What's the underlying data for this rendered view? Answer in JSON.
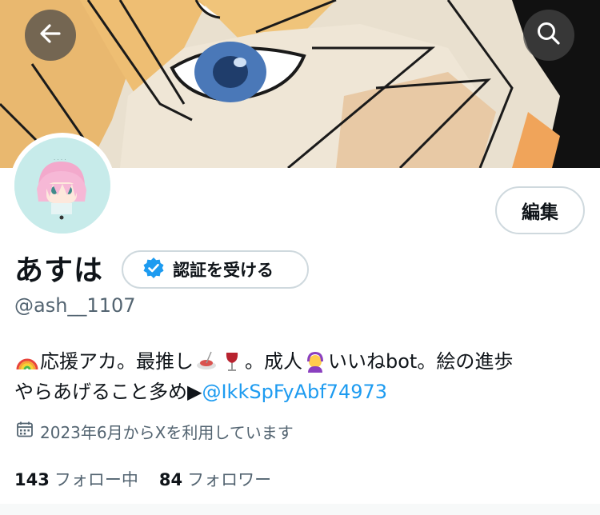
{
  "header": {
    "back_icon": "arrow-left-icon",
    "search_icon": "search-icon"
  },
  "profile": {
    "display_name": "あすは",
    "verify_label": "認証を受ける",
    "edit_label": "編集",
    "handle": "@ash__1107",
    "bio": {
      "line1_a": "応援アカ。最推し",
      "line1_b": "。成人",
      "line1_c": "いいねbot。絵の進歩",
      "line2_a": "やらあげること多め▶",
      "mention": "@IkkSpFyAbf74973"
    },
    "joined": "2023年6月からXを利用しています",
    "following_count": "143",
    "following_label": "フォロー中",
    "followers_count": "84",
    "followers_label": "フォロワー"
  },
  "colors": {
    "accent": "#1d9bf0",
    "secondary_text": "#536471",
    "border": "#cfd9de"
  }
}
